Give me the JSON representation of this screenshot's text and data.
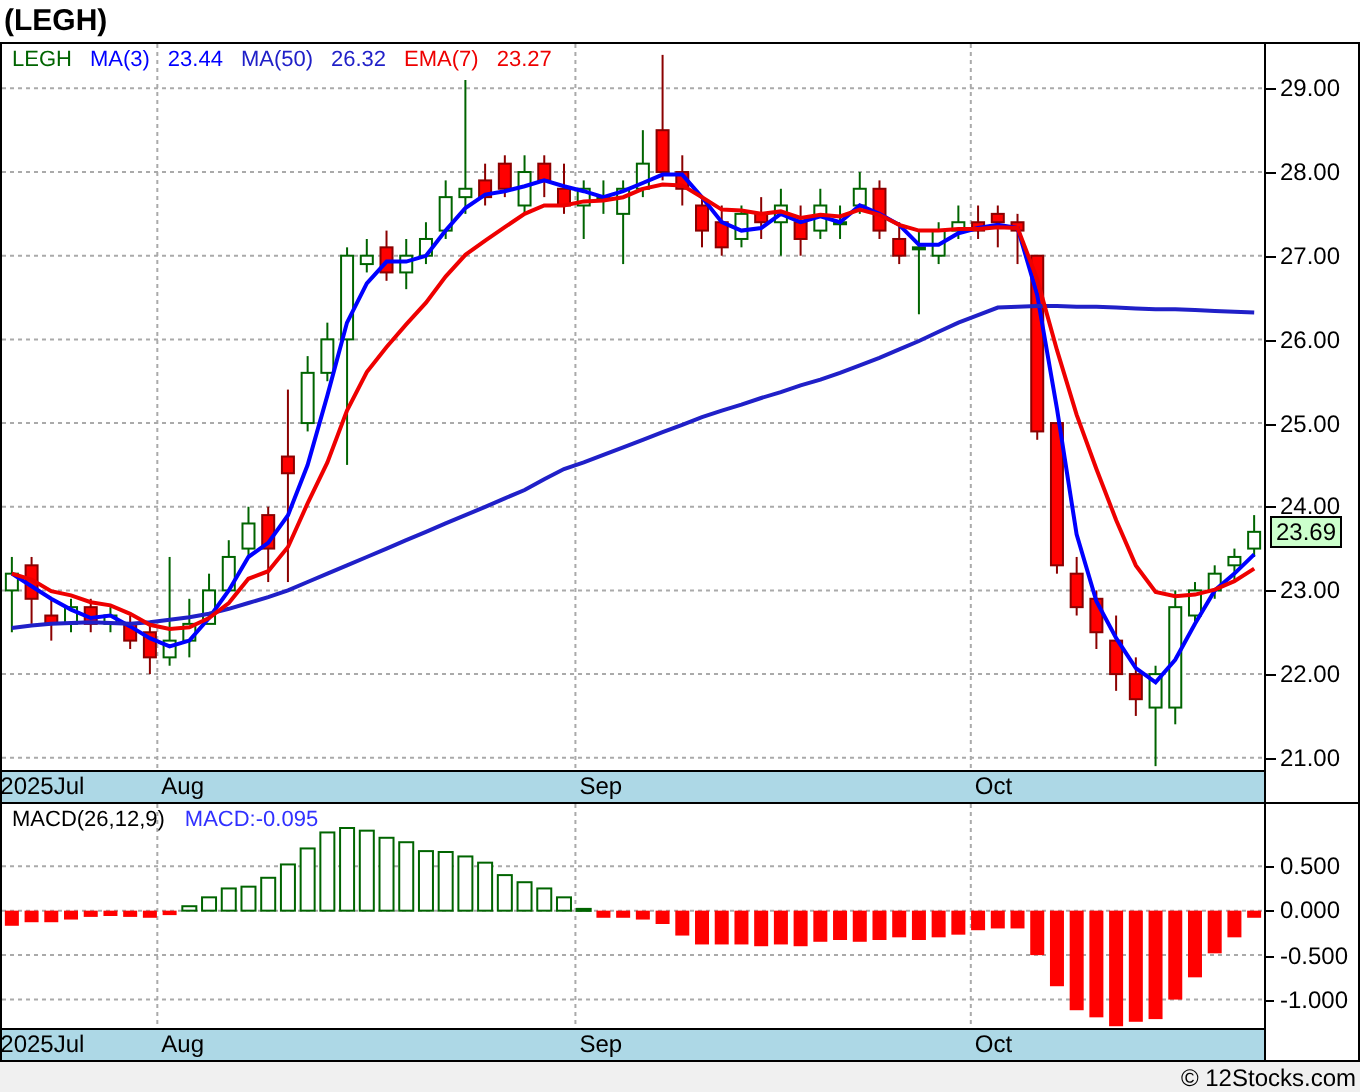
{
  "title": "(LEGH)",
  "price_pane": {
    "symbol": "LEGH",
    "readings": [
      "23.44",
      "26.32",
      "23.27"
    ],
    "last_price": "23.69",
    "chart_data": {
      "type": "candlestick",
      "grid": true,
      "categories": [
        null,
        null,
        "2025Jul",
        null,
        null,
        null,
        null,
        null,
        null,
        "Aug",
        null,
        null,
        null,
        null,
        null,
        null,
        null,
        null,
        null,
        null,
        null,
        null,
        null,
        null,
        null,
        null,
        null,
        null,
        null,
        null,
        "Sep",
        null,
        null,
        null,
        null,
        null,
        null,
        null,
        null,
        null,
        null,
        null,
        null,
        null,
        null,
        null,
        null,
        null,
        null,
        null,
        "Oct",
        null,
        null,
        null,
        null,
        null,
        null,
        null,
        null,
        null,
        null,
        null,
        null,
        null
      ],
      "ohlc": [
        [
          23.0,
          23.4,
          22.5,
          23.2
        ],
        [
          23.3,
          23.4,
          22.6,
          22.9
        ],
        [
          22.7,
          22.9,
          22.4,
          22.6
        ],
        [
          22.6,
          22.9,
          22.5,
          22.8
        ],
        [
          22.8,
          22.9,
          22.5,
          22.6
        ],
        [
          22.6,
          22.8,
          22.5,
          22.7
        ],
        [
          22.6,
          22.7,
          22.3,
          22.4
        ],
        [
          22.5,
          22.6,
          22.0,
          22.2
        ],
        [
          22.2,
          23.4,
          22.1,
          22.4
        ],
        [
          22.4,
          22.9,
          22.2,
          22.6
        ],
        [
          22.6,
          23.2,
          22.6,
          23.0
        ],
        [
          23.0,
          23.6,
          23.0,
          23.4
        ],
        [
          23.5,
          24.0,
          23.4,
          23.8
        ],
        [
          23.9,
          24.0,
          23.1,
          23.5
        ],
        [
          24.6,
          25.4,
          23.1,
          24.4
        ],
        [
          25.0,
          25.8,
          24.9,
          25.6
        ],
        [
          25.6,
          26.2,
          25.5,
          26.0
        ],
        [
          26.0,
          27.1,
          24.5,
          27.0
        ],
        [
          26.9,
          27.2,
          26.8,
          27.0
        ],
        [
          27.1,
          27.3,
          26.7,
          26.8
        ],
        [
          26.8,
          27.2,
          26.6,
          27.0
        ],
        [
          27.0,
          27.4,
          26.9,
          27.2
        ],
        [
          27.3,
          27.9,
          27.2,
          27.7
        ],
        [
          27.7,
          29.1,
          27.5,
          27.8
        ],
        [
          27.9,
          28.1,
          27.6,
          27.7
        ],
        [
          28.1,
          28.2,
          27.7,
          27.8
        ],
        [
          27.6,
          28.2,
          27.5,
          28.0
        ],
        [
          28.1,
          28.2,
          27.7,
          27.9
        ],
        [
          27.8,
          28.1,
          27.5,
          27.6
        ],
        [
          27.6,
          27.9,
          27.2,
          27.8
        ],
        [
          27.7,
          27.9,
          27.5,
          27.7
        ],
        [
          27.5,
          27.9,
          26.9,
          27.8
        ],
        [
          27.8,
          28.5,
          27.7,
          28.1
        ],
        [
          28.5,
          29.4,
          27.9,
          28.0
        ],
        [
          28.0,
          28.2,
          27.6,
          27.8
        ],
        [
          27.6,
          27.7,
          27.1,
          27.3
        ],
        [
          27.4,
          27.6,
          27.0,
          27.1
        ],
        [
          27.2,
          27.6,
          27.1,
          27.5
        ],
        [
          27.5,
          27.7,
          27.2,
          27.4
        ],
        [
          27.4,
          27.8,
          27.0,
          27.6
        ],
        [
          27.4,
          27.6,
          27.0,
          27.2
        ],
        [
          27.3,
          27.8,
          27.2,
          27.6
        ],
        [
          27.4,
          27.6,
          27.2,
          27.4
        ],
        [
          27.6,
          28.0,
          27.5,
          27.8
        ],
        [
          27.8,
          27.9,
          27.2,
          27.3
        ],
        [
          27.2,
          27.4,
          26.9,
          27.0
        ],
        [
          27.1,
          27.3,
          26.3,
          27.1
        ],
        [
          27.0,
          27.4,
          26.9,
          27.3
        ],
        [
          27.3,
          27.6,
          27.2,
          27.4
        ],
        [
          27.4,
          27.6,
          27.2,
          27.3
        ],
        [
          27.5,
          27.6,
          27.1,
          27.4
        ],
        [
          27.4,
          27.5,
          26.9,
          27.3
        ],
        [
          27.0,
          27.0,
          24.8,
          24.9
        ],
        [
          25.0,
          25.0,
          23.2,
          23.3
        ],
        [
          23.2,
          23.4,
          22.7,
          22.8
        ],
        [
          22.9,
          23.0,
          22.3,
          22.5
        ],
        [
          22.4,
          22.7,
          21.8,
          22.0
        ],
        [
          22.0,
          22.2,
          21.5,
          21.7
        ],
        [
          21.6,
          22.1,
          20.9,
          22.0
        ],
        [
          21.6,
          23.0,
          21.4,
          22.8
        ],
        [
          22.7,
          23.1,
          22.6,
          23.0
        ],
        [
          23.0,
          23.3,
          22.9,
          23.2
        ],
        [
          23.3,
          23.5,
          23.1,
          23.4
        ],
        [
          23.5,
          23.9,
          23.4,
          23.7
        ]
      ],
      "series": [
        {
          "name": "MA(3)",
          "type": "line",
          "color": "#0000ff",
          "values": [
            23.2,
            23.05,
            22.9,
            22.77,
            22.67,
            22.7,
            22.57,
            22.43,
            22.33,
            22.4,
            22.67,
            23.0,
            23.4,
            23.57,
            23.9,
            24.5,
            25.33,
            26.2,
            26.67,
            26.93,
            26.93,
            27.0,
            27.3,
            27.57,
            27.73,
            27.77,
            27.83,
            27.9,
            27.83,
            27.77,
            27.7,
            27.77,
            27.87,
            27.97,
            27.97,
            27.7,
            27.4,
            27.3,
            27.33,
            27.5,
            27.4,
            27.47,
            27.4,
            27.6,
            27.5,
            27.37,
            27.13,
            27.13,
            27.27,
            27.33,
            27.37,
            27.33,
            26.53,
            25.17,
            23.67,
            22.87,
            22.43,
            22.07,
            21.9,
            22.17,
            22.6,
            23.0,
            23.2,
            23.43
          ]
        },
        {
          "name": "MA(50)",
          "type": "line",
          "color": "#2020c8",
          "values": [
            22.55,
            22.58,
            22.6,
            22.61,
            22.62,
            22.61,
            22.6,
            22.62,
            22.65,
            22.68,
            22.72,
            22.78,
            22.85,
            22.92,
            23.0,
            23.1,
            23.2,
            23.3,
            23.4,
            23.5,
            23.6,
            23.7,
            23.8,
            23.9,
            24.0,
            24.1,
            24.2,
            24.33,
            24.45,
            24.53,
            24.62,
            24.71,
            24.8,
            24.89,
            24.98,
            25.07,
            25.15,
            25.22,
            25.3,
            25.37,
            25.45,
            25.52,
            25.6,
            25.69,
            25.78,
            25.88,
            25.98,
            26.09,
            26.2,
            26.29,
            26.38,
            26.39,
            26.4,
            26.4,
            26.39,
            26.39,
            26.38,
            26.37,
            26.36,
            26.36,
            26.35,
            26.34,
            26.33,
            26.32
          ]
        },
        {
          "name": "EMA(7)",
          "type": "line",
          "color": "#ee0000",
          "values": [
            23.2,
            23.13,
            22.99,
            22.94,
            22.86,
            22.82,
            22.72,
            22.59,
            22.54,
            22.56,
            22.67,
            22.85,
            23.14,
            23.23,
            23.52,
            24.04,
            24.53,
            25.15,
            25.61,
            25.91,
            26.18,
            26.44,
            26.75,
            27.01,
            27.18,
            27.34,
            27.5,
            27.6,
            27.6,
            27.65,
            27.66,
            27.7,
            27.8,
            27.85,
            27.84,
            27.7,
            27.55,
            27.54,
            27.5,
            27.53,
            27.45,
            27.49,
            27.47,
            27.55,
            27.49,
            27.37,
            27.3,
            27.3,
            27.32,
            27.32,
            27.34,
            27.33,
            26.72,
            25.87,
            25.1,
            24.45,
            23.84,
            23.3,
            22.98,
            22.93,
            22.95,
            23.01,
            23.11,
            23.26
          ]
        }
      ],
      "ylim": [
        20.83,
        29.53
      ],
      "yticks": [
        {
          "value": 29,
          "label": "29.00"
        },
        {
          "value": 28,
          "label": "28.00"
        },
        {
          "value": 27,
          "label": "27.00"
        },
        {
          "value": 26,
          "label": "26.00"
        },
        {
          "value": 25,
          "label": "25.00"
        },
        {
          "value": 24,
          "label": "24.00"
        },
        {
          "value": 23,
          "label": "23.00"
        },
        {
          "value": 22,
          "label": "22.00"
        },
        {
          "value": 21,
          "label": "21.00"
        }
      ]
    }
  },
  "macd_pane": {
    "reading": "MACD:-0.095",
    "chart_data": {
      "type": "bar",
      "grid": true,
      "categories": [
        null,
        null,
        "2025Jul",
        null,
        null,
        null,
        null,
        null,
        null,
        "Aug",
        null,
        null,
        null,
        null,
        null,
        null,
        null,
        null,
        null,
        null,
        null,
        null,
        null,
        null,
        null,
        null,
        null,
        null,
        null,
        null,
        "Sep",
        null,
        null,
        null,
        null,
        null,
        null,
        null,
        null,
        null,
        null,
        null,
        null,
        null,
        null,
        null,
        null,
        null,
        null,
        null,
        "Oct",
        null,
        null,
        null,
        null,
        null,
        null,
        null,
        null,
        null,
        null,
        null,
        null,
        null
      ],
      "series": [
        {
          "name": "MACD(26,12,9)",
          "values": [
            -0.17,
            -0.13,
            -0.13,
            -0.1,
            -0.07,
            -0.06,
            -0.07,
            -0.08,
            -0.05,
            0.05,
            0.15,
            0.25,
            0.27,
            0.37,
            0.52,
            0.7,
            0.88,
            0.93,
            0.9,
            0.82,
            0.77,
            0.67,
            0.66,
            0.61,
            0.54,
            0.4,
            0.32,
            0.25,
            0.15,
            0.02,
            -0.08,
            -0.08,
            -0.1,
            -0.15,
            -0.28,
            -0.38,
            -0.38,
            -0.38,
            -0.4,
            -0.38,
            -0.4,
            -0.35,
            -0.33,
            -0.35,
            -0.33,
            -0.3,
            -0.33,
            -0.3,
            -0.27,
            -0.22,
            -0.2,
            -0.2,
            -0.5,
            -0.85,
            -1.12,
            -1.2,
            -1.3,
            -1.25,
            -1.22,
            -1.0,
            -0.75,
            -0.48,
            -0.3,
            -0.08
          ]
        }
      ],
      "ylim": [
        -1.32,
        1.2
      ],
      "yticks": [
        {
          "value": 0.5,
          "label": "0.500"
        },
        {
          "value": 0,
          "label": "0.000"
        },
        {
          "value": -0.5,
          "label": "-0.500"
        },
        {
          "value": -1,
          "label": "-1.000"
        }
      ]
    }
  },
  "credit": "© 12Stocks.com"
}
